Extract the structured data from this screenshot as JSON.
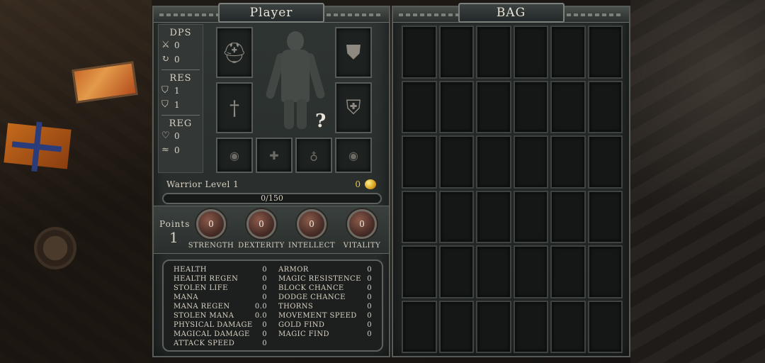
{
  "player_panel": {
    "title": "Player",
    "dps": {
      "heading": "DPS",
      "physical": "0",
      "magical": "0"
    },
    "res": {
      "heading": "RES",
      "armor": "1",
      "magic": "1"
    },
    "reg": {
      "heading": "REG",
      "health": "0",
      "mana": "0"
    },
    "help_mark": "?",
    "level_text": "Warrior Level 1",
    "gold": "0",
    "xp_text": "0/150",
    "points_label": "Points",
    "points_value": "1",
    "attributes": [
      {
        "name": "STRENGTH",
        "value": "0"
      },
      {
        "name": "DEXTERITY",
        "value": "0"
      },
      {
        "name": "INTELLECT",
        "value": "0"
      },
      {
        "name": "VITALITY",
        "value": "0"
      }
    ],
    "stats_left": [
      {
        "label": "HEALTH",
        "value": "0"
      },
      {
        "label": "HEALTH REGEN",
        "value": "0"
      },
      {
        "label": "STOLEN LIFE",
        "value": "0"
      },
      {
        "label": "MANA",
        "value": "0"
      },
      {
        "label": "MANA REGEN",
        "value": "0.0"
      },
      {
        "label": "STOLEN MANA",
        "value": "0.0"
      },
      {
        "label": "PHYSICAL DAMAGE",
        "value": "0"
      },
      {
        "label": "MAGICAL DAMAGE",
        "value": "0"
      },
      {
        "label": "ATTACK SPEED",
        "value": "0"
      }
    ],
    "stats_right": [
      {
        "label": "ARMOR",
        "value": "0"
      },
      {
        "label": "MAGIC RESISTENCE",
        "value": "0"
      },
      {
        "label": "BLOCK CHANCE",
        "value": "0"
      },
      {
        "label": "DODGE CHANCE",
        "value": "0"
      },
      {
        "label": "THORNS",
        "value": "0"
      },
      {
        "label": "MOVEMENT SPEED",
        "value": "0"
      },
      {
        "label": "GOLD FIND",
        "value": "0"
      },
      {
        "label": "MAGIC FIND",
        "value": "0"
      }
    ],
    "equipment_icons": {
      "helmet": "helmet-icon",
      "chest": "chest-armor-icon",
      "weapon": "sword-icon",
      "shield": "shield-icon",
      "ring1": "ring-icon",
      "amulet1": "cross-amulet-icon",
      "amulet2": "pendant-icon",
      "ring2": "ring-icon"
    }
  },
  "bag_panel": {
    "title": "BAG",
    "rows": 6,
    "cols": 6
  },
  "colors": {
    "panel": "#2b302f",
    "border": "#565b58",
    "gold": "#e9c34a",
    "text": "#d8d2c4"
  }
}
